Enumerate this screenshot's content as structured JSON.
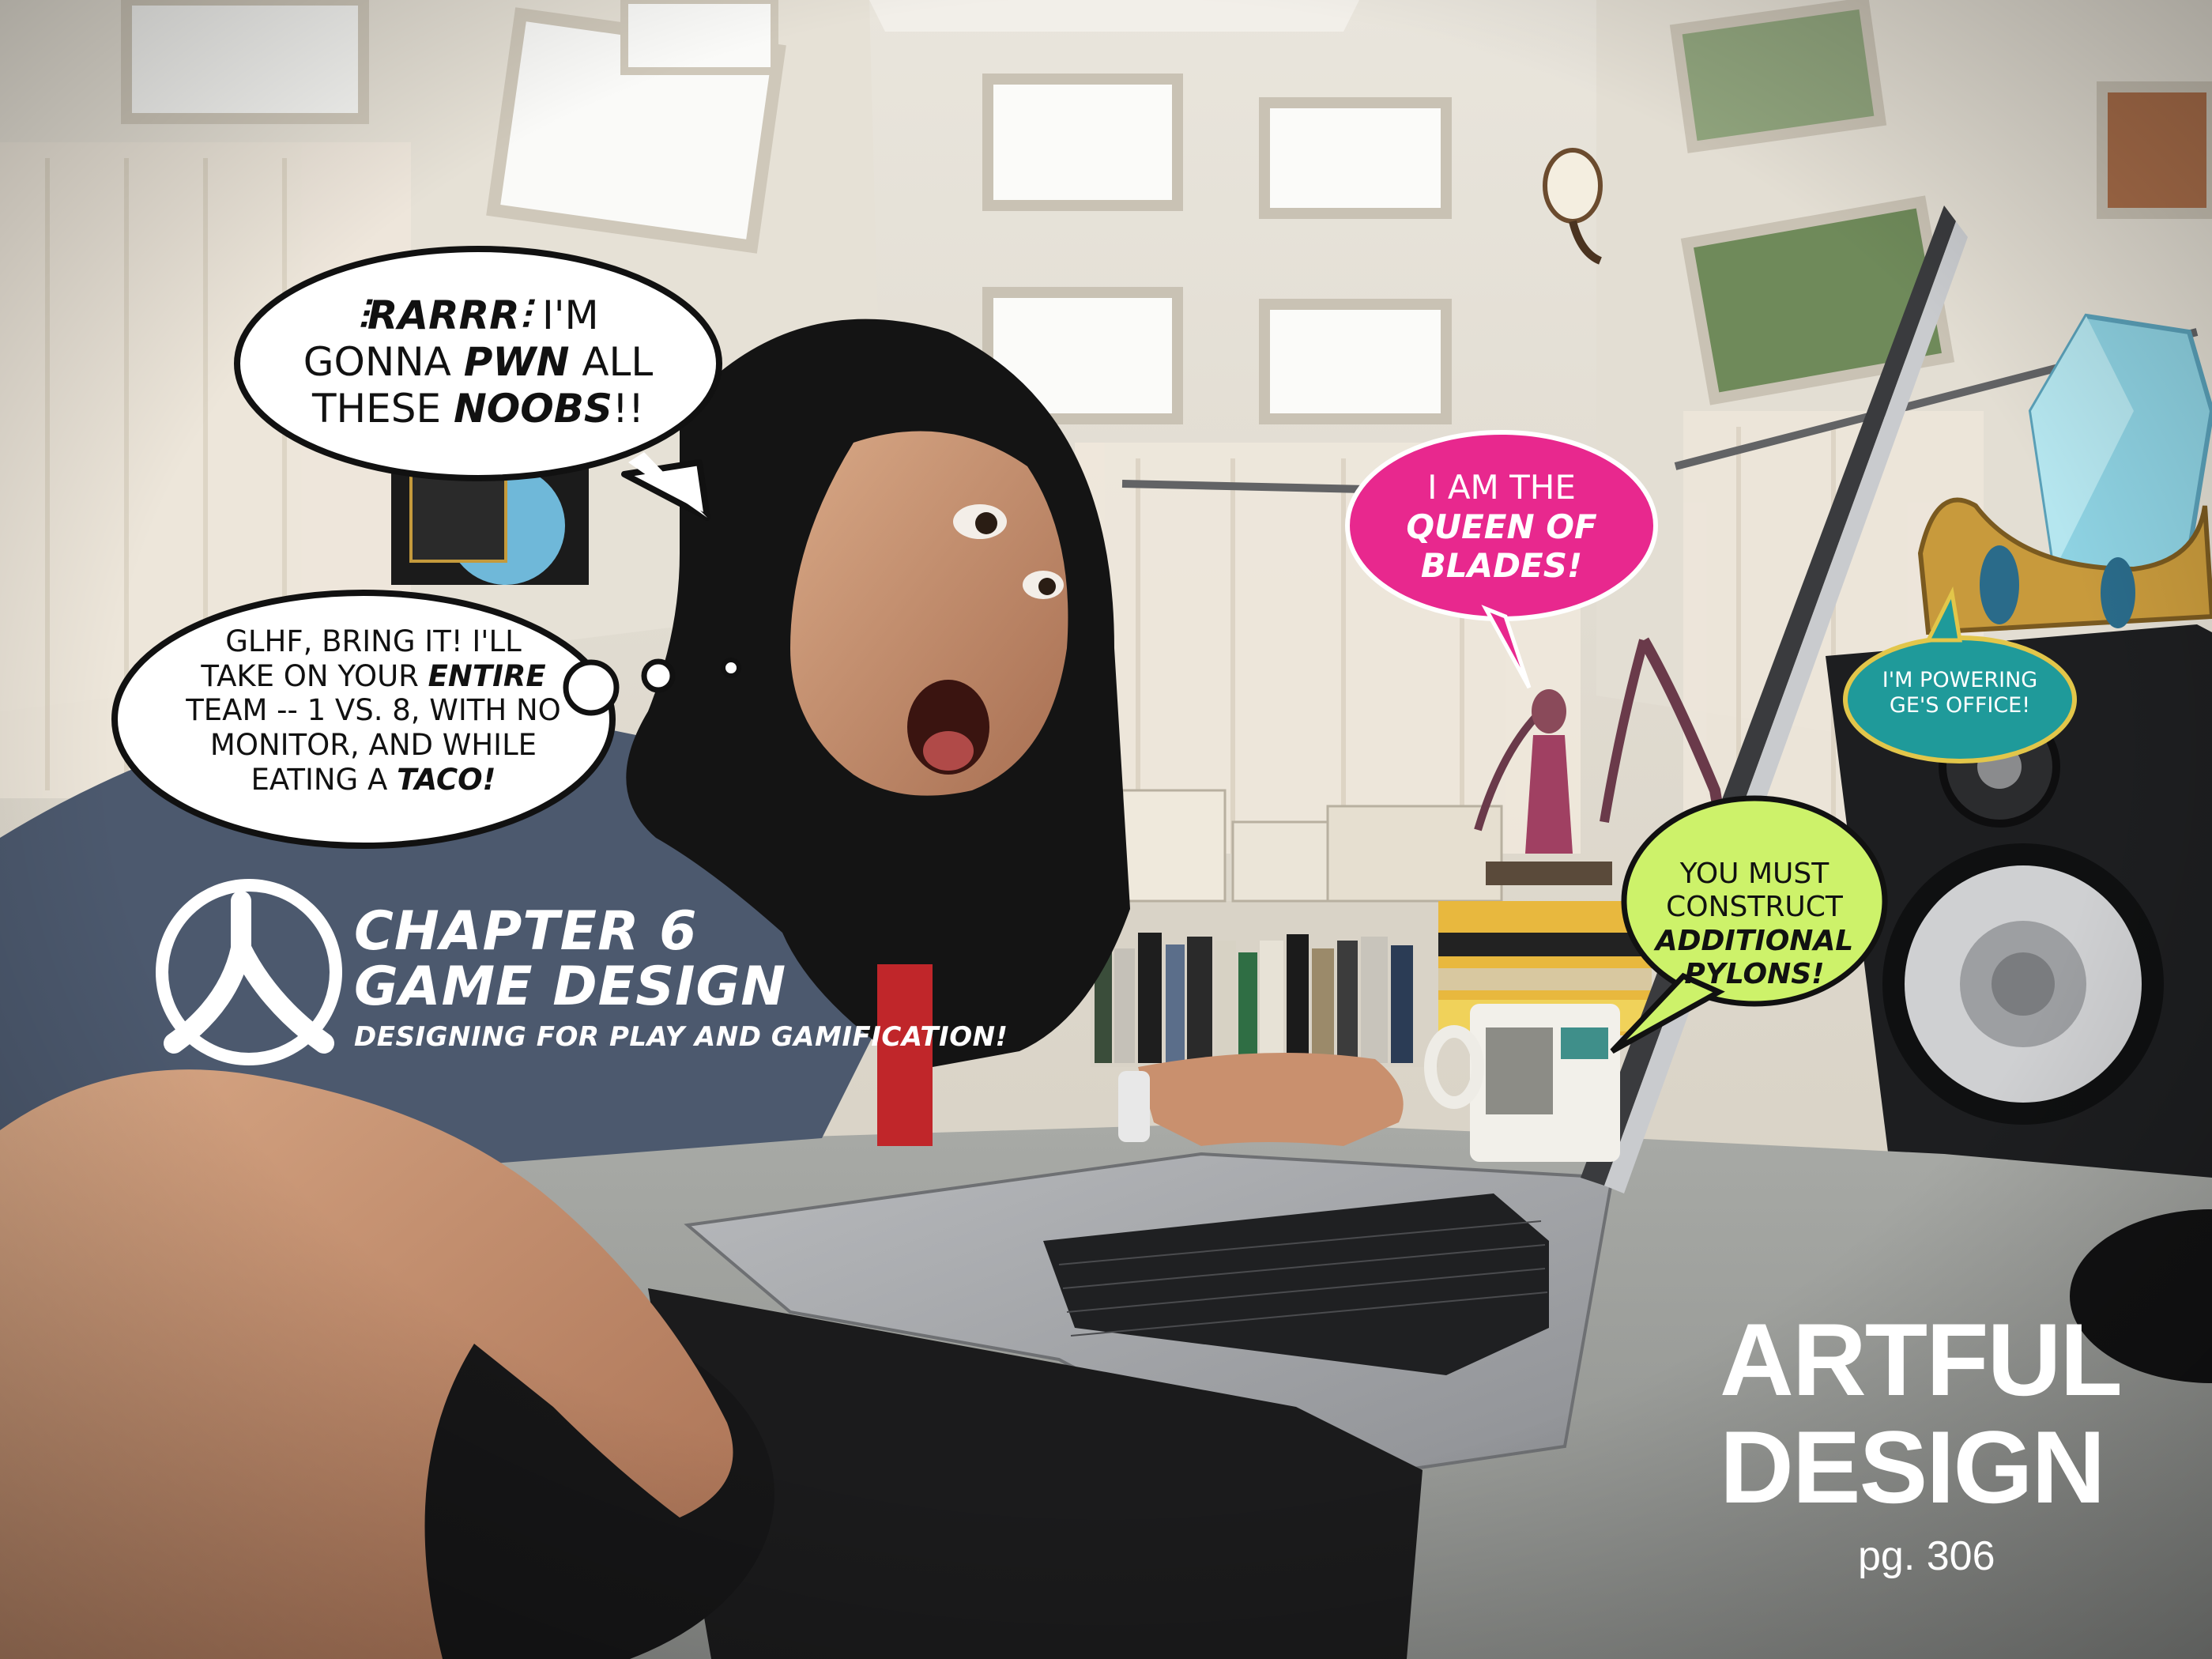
{
  "bubbles": {
    "rarr": {
      "line1_bold": "⫶RARRR⫶",
      "line1_rest": "I'M",
      "line2_pre": "GONNA",
      "line2_bold": "PWN",
      "line2_post": "ALL",
      "line3_pre": "THESE",
      "line3_bold": "NOOBS",
      "line3_post": "!!"
    },
    "glhf": {
      "line1": "GLHF, BRING IT! I'LL",
      "line2_pre": "TAKE ON YOUR",
      "line2_bold": "ENTIRE",
      "line3": "TEAM -- 1 VS. 8, WITH NO",
      "line4": "MONITOR, AND WHILE",
      "line5_pre": "EATING A",
      "line5_bold": "TACO!"
    },
    "queen": {
      "line1": "I AM THE",
      "line2": "QUEEN OF",
      "line3": "BLADES!"
    },
    "pylons": {
      "line1": "YOU MUST",
      "line2": "CONSTRUCT",
      "line3": "ADDITIONAL",
      "line4": "PYLONS!"
    },
    "powering": {
      "line1": "I'M POWERING",
      "line2": "GE'S OFFICE!"
    }
  },
  "chapter": {
    "title_line1": "CHAPTER 6",
    "title_line2": "GAME DESIGN",
    "subtitle_pre": "DESIGNING FOR",
    "subtitle_bold1": "PLAY",
    "subtitle_mid": "AND",
    "subtitle_bold2": "GAMIFICATION!"
  },
  "brand": {
    "word1": "ARTFUL",
    "word2": "DESIGN",
    "page": "pg. 306"
  },
  "colors": {
    "queen_bubble": "#e8288e",
    "pylons_bubble": "#cdf26a",
    "powering_bubble": "#1f9a9a",
    "powering_border": "#e2c64a"
  }
}
